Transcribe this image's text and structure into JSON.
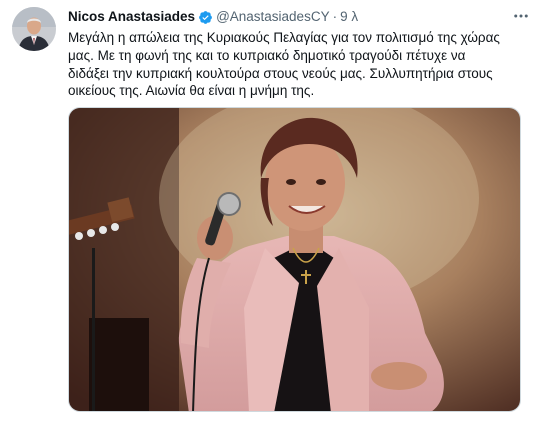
{
  "tweet": {
    "author_name": "Nicos Anastasiades",
    "handle": "@AnastasiadesCY",
    "separator": "·",
    "time": "9 λ",
    "text_lines": [
      "Μεγάλη η απώλεια της Κυριακούς Πελαγίας για τον πολιτισμό της χώρας",
      "μας. Με τη φωνή της και το κυπριακό δημοτικό τραγούδι πέτυχε να",
      "διδάξει την κυπριακή κουλτούρα στους νεούς μας. Συλλυπητήρια στους",
      "οικείους της. Αιωνία θα είναι η μνήμη της."
    ]
  },
  "icons": {
    "verified": "verified-badge-icon",
    "more": "more-options-icon"
  },
  "colors": {
    "verified_blue": "#1d9bf0",
    "secondary_text": "#536471",
    "primary_text": "#0f1419",
    "border": "#cfd9de"
  }
}
